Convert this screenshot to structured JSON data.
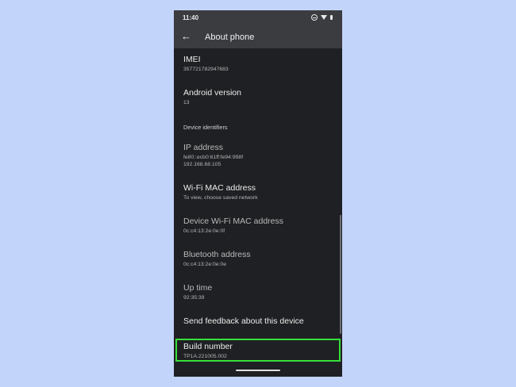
{
  "status": {
    "time": "11:40"
  },
  "appbar": {
    "title": "About phone"
  },
  "items": [
    {
      "title": "IMEI",
      "sub": "357721782947683"
    },
    {
      "title": "Android version",
      "sub": "13"
    },
    {
      "title": "IP address",
      "sub": "fe80::ecb0:61ff:fe94:998f",
      "sub2": "192.168.68.105"
    },
    {
      "title": "Wi-Fi MAC address",
      "sub": "To view, choose saved network"
    },
    {
      "title": "Device Wi-Fi MAC address",
      "sub": "0c:c4:13:2e:0e:0f"
    },
    {
      "title": "Bluetooth address",
      "sub": "0c:c4:13:2e:0e:0e"
    },
    {
      "title": "Up time",
      "sub": "92:35:39"
    },
    {
      "title": "Send feedback about this device"
    },
    {
      "title": "Build number",
      "sub": "TP1A.221005.002"
    }
  ],
  "section": {
    "device_identifiers": "Device identifiers"
  },
  "colors": {
    "background": "#c3d4fb",
    "highlight": "#36e03a",
    "screen": "#1f2023",
    "appbar": "#3b3c40"
  }
}
